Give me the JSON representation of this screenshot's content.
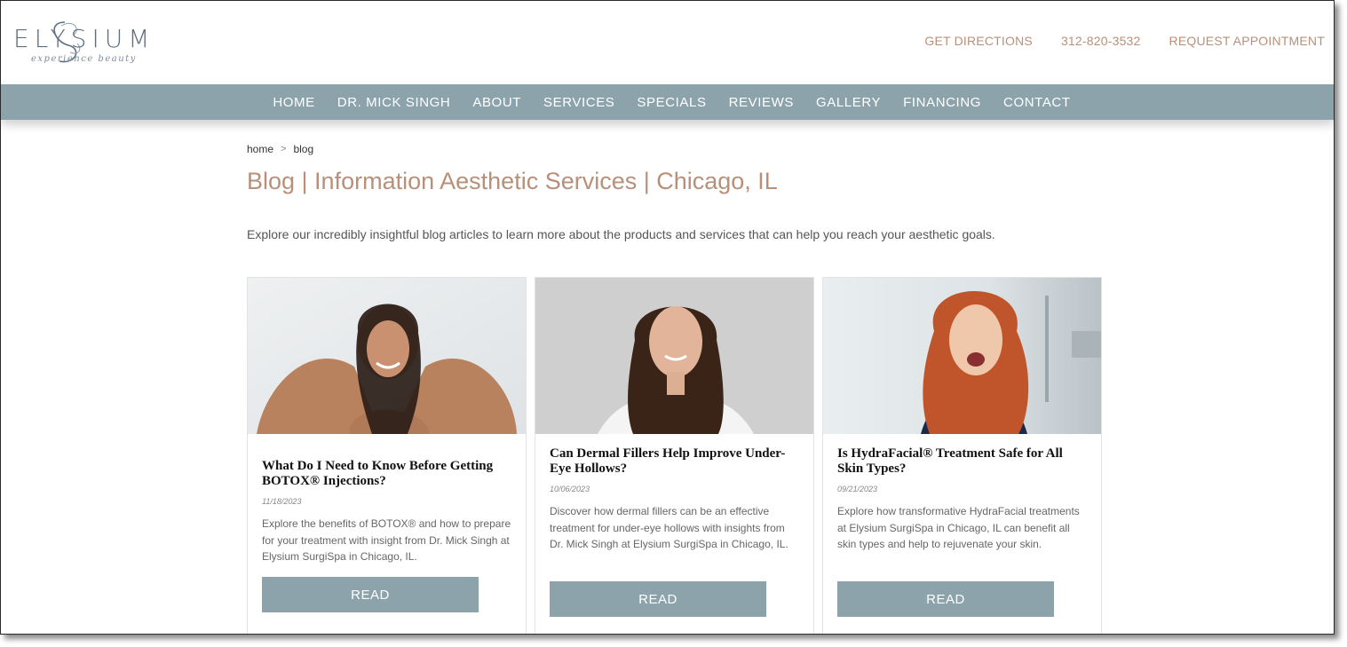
{
  "header": {
    "logo_text": "ELYSIUM",
    "logo_tagline": "experience beauty",
    "links": [
      "GET DIRECTIONS",
      "312-820-3532",
      "REQUEST APPOINTMENT"
    ]
  },
  "nav": [
    "HOME",
    "DR. MICK SINGH",
    "ABOUT",
    "SERVICES",
    "SPECIALS",
    "REVIEWS",
    "GALLERY",
    "FINANCING",
    "CONTACT"
  ],
  "breadcrumb": {
    "home": "home",
    "separator": ">",
    "current": "blog"
  },
  "page_title": "Blog | Information Aesthetic Services | Chicago, IL",
  "intro": "Explore our incredibly insightful blog articles to learn more about the products and services that can help you reach your aesthetic goals.",
  "cards": [
    {
      "title": "What Do I Need to Know Before Getting BOTOX® Injections?",
      "date": "11/18/2023",
      "excerpt": "Explore the benefits of BOTOX® and how to prepare for your treatment with insight from Dr. Mick Singh at Elysium SurgiSpa in Chicago, IL.",
      "button": "READ"
    },
    {
      "title": "Can Dermal Fillers Help Improve Under-Eye Hollows?",
      "date": "10/06/2023",
      "excerpt": "Discover how dermal fillers can be an effective treatment for under-eye hollows with insights from Dr. Mick Singh at Elysium SurgiSpa in Chicago, IL.",
      "button": "READ"
    },
    {
      "title": "Is HydraFacial® Treatment Safe for All Skin Types?",
      "date": "09/21/2023",
      "excerpt": "Explore how transformative HydraFacial treatments at Elysium SurgiSpa in Chicago, IL can benefit all skin types and help to rejuvenate your skin.",
      "button": "READ"
    }
  ],
  "colors": {
    "nav_bg": "#8ca3ac",
    "accent": "#b8907a",
    "button_bg": "#8ca3ac"
  }
}
